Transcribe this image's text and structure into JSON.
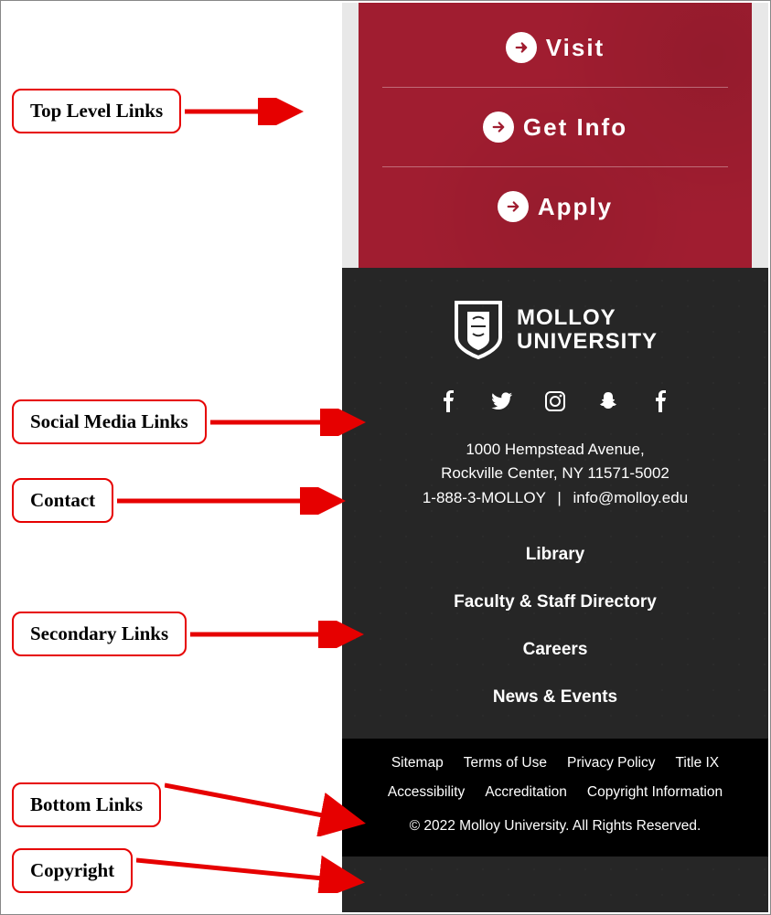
{
  "annotations": {
    "top": "Top Level Links",
    "social": "Social Media Links",
    "contact": "Contact",
    "secondary": "Secondary Links",
    "bottom": "Bottom Links",
    "copyright": "Copyright"
  },
  "cta": [
    {
      "label": "Visit"
    },
    {
      "label": "Get Info"
    },
    {
      "label": "Apply"
    }
  ],
  "logo": {
    "line1": "MOLLOY",
    "line2": "UNIVERSITY"
  },
  "social_icons": [
    "facebook",
    "twitter",
    "instagram",
    "snapchat",
    "facebook"
  ],
  "contact": {
    "line1": "1000 Hempstead Avenue,",
    "line2": "Rockville Center, NY 11571-5002",
    "phone": "1-888-3-MOLLOY",
    "email": "info@molloy.edu"
  },
  "secondary": [
    "Library",
    "Faculty & Staff Directory",
    "Careers",
    "News & Events"
  ],
  "bottom": [
    "Sitemap",
    "Terms of Use",
    "Privacy Policy",
    "Title IX",
    "Accessibility",
    "Accreditation",
    "Copyright Information"
  ],
  "copyright": "© 2022 Molloy University. All Rights Reserved."
}
